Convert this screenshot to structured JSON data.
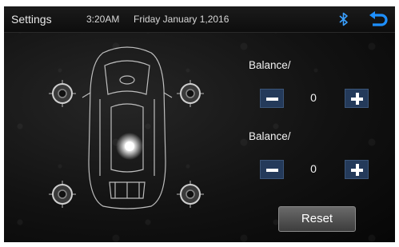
{
  "statusbar": {
    "title": "Settings",
    "time": "3:20AM",
    "date": "Friday January 1,2016",
    "bluetooth_icon": "bluetooth-icon",
    "back_icon": "back-arrow-icon"
  },
  "balance": {
    "label_1": "Balance/",
    "value_1": "0",
    "label_2": "Balance/",
    "value_2": "0"
  },
  "reset_label": "Reset",
  "colors": {
    "accent_blue": "#1e90ff",
    "button_bg": "#243a5a"
  }
}
